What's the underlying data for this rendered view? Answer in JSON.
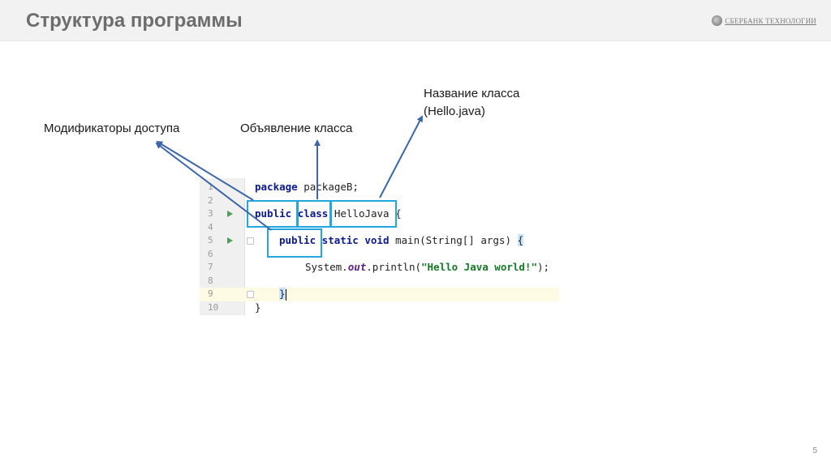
{
  "header": {
    "title": "Структура программы",
    "logo_text": "СБЕРБАНК ТЕХНОЛОГИИ"
  },
  "labels": {
    "access_modifiers": "Модификаторы доступа",
    "class_declaration": "Объявление класса",
    "class_name_line1": "Название класса",
    "class_name_line2": "(Hello.java)"
  },
  "code": {
    "line_numbers": [
      "1",
      "2",
      "3",
      "4",
      "5",
      "6",
      "7",
      "8",
      "9",
      "10"
    ],
    "line1_kw": "package",
    "line1_rest": " packageB;",
    "line3_kw1": "public",
    "line3_kw2": "class",
    "line3_rest": " HelloJava {",
    "line5_kw1": "public",
    "line5_kw2": " static void",
    "line5_rest": " main(String[] args) ",
    "line5_brace": "{",
    "line7_a": "System.",
    "line7_out": "out",
    "line7_b": ".println(",
    "line7_str": "\"Hello Java world!\"",
    "line7_c": ");",
    "line9_brace": "}",
    "line10_brace": "}"
  },
  "page_number": "5",
  "colors": {
    "highlight_box": "#24a6e0",
    "arrow": "#3d66a8",
    "keyword": "#0b1a8a",
    "string": "#157a25"
  }
}
